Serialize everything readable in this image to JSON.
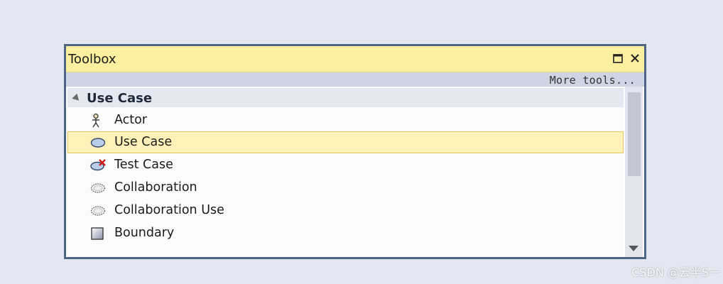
{
  "window": {
    "title": "Toolbox",
    "maximize_icon": "maximize-icon",
    "close_icon": "close-icon"
  },
  "toolbar": {
    "more_tools": "More tools..."
  },
  "group": {
    "label": "Use Case",
    "expanded": true,
    "icon": "collapse-arrow-icon"
  },
  "items": [
    {
      "label": "Actor",
      "icon": "actor-icon",
      "selected": false
    },
    {
      "label": "Use Case",
      "icon": "use-case-icon",
      "selected": true
    },
    {
      "label": "Test Case",
      "icon": "test-case-icon",
      "selected": false
    },
    {
      "label": "Collaboration",
      "icon": "collaboration-icon",
      "selected": false
    },
    {
      "label": "Collaboration Use",
      "icon": "collaboration-use-icon",
      "selected": false
    },
    {
      "label": "Boundary",
      "icon": "boundary-icon",
      "selected": false
    }
  ],
  "watermark": "CSDN @云半S一",
  "colors": {
    "titlebar": "#fcef9f",
    "selection": "#fef2b8",
    "frame": "#4f6586"
  }
}
